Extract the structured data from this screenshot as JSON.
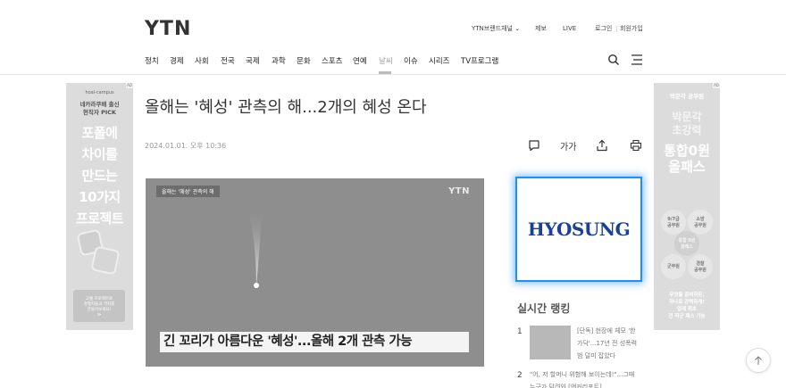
{
  "header": {
    "logo": "YTN",
    "top_links": {
      "brand": "YTN브랜드채널",
      "report": "제보",
      "live": "LIVE",
      "login": "로그인",
      "separator": "|",
      "join": "회원가입"
    },
    "nav": [
      "정치",
      "경제",
      "사회",
      "전국",
      "국제",
      "과학",
      "문화",
      "스포츠",
      "연예",
      "날씨",
      "이슈",
      "시리즈",
      "TV프로그램"
    ],
    "active_nav": "날씨"
  },
  "left_ad": {
    "brand": "hoal-campus",
    "sub": [
      "네카라쿠배 출신",
      "현직자 PICK"
    ],
    "big": [
      "포폴에",
      "차이를",
      "만드는",
      "10가지",
      "프로젝트"
    ],
    "box": [
      "고퀄 프로젝트로",
      "경쟁자들과 격차를",
      "만들어보세요!",
      "≫"
    ],
    "ad_mark": "AD"
  },
  "right_ad": {
    "t1": "박문각 공무원",
    "t2": [
      "박문각",
      "초강력"
    ],
    "t3": [
      "통합0원",
      "올패스"
    ],
    "cells": [
      [
        "9/7급",
        "공무원"
      ],
      [
        "소방",
        "공무원"
      ],
      [
        "군무원"
      ],
      [
        "경찰",
        "공무원"
      ]
    ],
    "center_cell": [
      "통합 0원",
      "올패스"
    ],
    "foot": [
      "무엇을 준비하든,",
      "하나로 강력하게!",
      "업계 최초",
      "전 직군 패스 가능"
    ],
    "ad_mark": "AD"
  },
  "article": {
    "title": "올해는 '혜성' 관측의 해...2개의 혜성 온다",
    "date": "2024.01.01. 오후 10:36",
    "font_tool": "가가",
    "video": {
      "tag": "올해는 '혜성' 관측의 해",
      "logo": "YTN",
      "caption": "긴 꼬리가 아름다운 '혜성'...올해 2개 관측 가능"
    }
  },
  "sidebar": {
    "ad_brand": "HYOSUNG",
    "ranking_title": "실시간 랭킹",
    "ranking": [
      {
        "num": "1",
        "lines": [
          "[단독] 현장에 체모 '한",
          "가닥'...17년 전 성폭력",
          "범 덜미 잡았다"
        ]
      },
      {
        "num": "2",
        "lines": [
          "\"어, 저 할머니 위험해 보이는데!\"...그때",
          "누구가 달려와 [앤커리포트]"
        ]
      }
    ]
  },
  "colors": {
    "highlight_border": "#1a8fff",
    "hyosung_text": "#1c3f98"
  }
}
